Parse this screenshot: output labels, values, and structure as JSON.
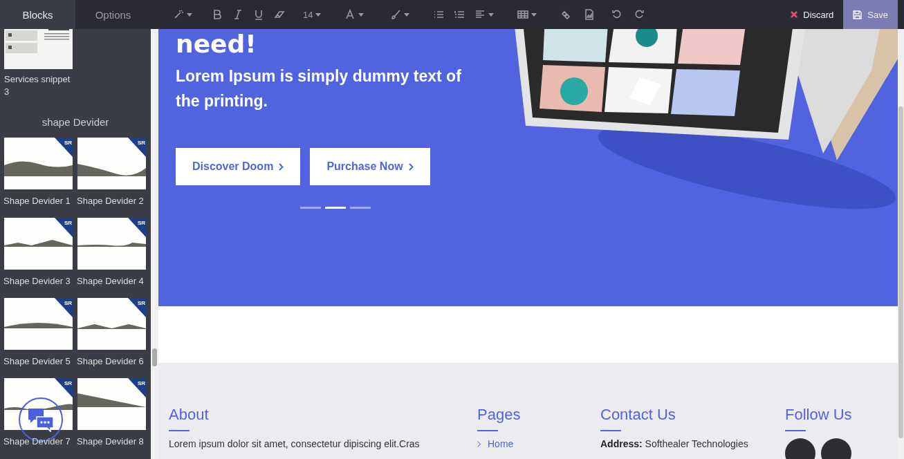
{
  "editor_tabs": [
    {
      "label": "Blocks",
      "selected": true
    },
    {
      "label": "Options",
      "selected": false
    }
  ],
  "toolbar": {
    "font_size": "14"
  },
  "actions": [
    {
      "label": "Discard",
      "kind": "discard"
    },
    {
      "label": "Save",
      "kind": "save"
    }
  ],
  "sidebar": {
    "snippets": [
      {
        "label": "Services snippet 3"
      }
    ],
    "section_title": "shape Devider",
    "dividers": [
      {
        "label": "Shape Devider 1",
        "badge": "SR"
      },
      {
        "label": "Shape Devider 2",
        "badge": "SR"
      },
      {
        "label": "Shape Devider 3",
        "badge": "SR"
      },
      {
        "label": "Shape Devider 4",
        "badge": "SR"
      },
      {
        "label": "Shape Devider 5",
        "badge": "SR"
      },
      {
        "label": "Shape Devider 6",
        "badge": "SR"
      },
      {
        "label": "Shape Devider 7",
        "badge": "SR"
      },
      {
        "label": "Shape Devider 8",
        "badge": "SR"
      }
    ]
  },
  "hero": {
    "heading": "need!",
    "subtitle": "Lorem Ipsum is simply dummy text of the printing.",
    "buttons": [
      "Discover Doom",
      "Purchase Now"
    ],
    "slides": [
      {
        "selected": false
      },
      {
        "selected": true
      },
      {
        "selected": false
      }
    ]
  },
  "footer": {
    "columns": [
      {
        "kind": "text",
        "heading": "About",
        "text": "Lorem ipsum dolor sit amet, consectetur dipiscing elit.Cras"
      },
      {
        "kind": "links",
        "heading": "Pages",
        "links": [
          "Home"
        ]
      },
      {
        "kind": "text",
        "heading": "Contact Us",
        "text": "**Address:** Softhealer Technologies"
      },
      {
        "kind": "social",
        "heading": "Follow Us",
        "icons": [
          {
            "kind": "circle"
          },
          {
            "kind": "circle"
          }
        ]
      }
    ]
  }
}
